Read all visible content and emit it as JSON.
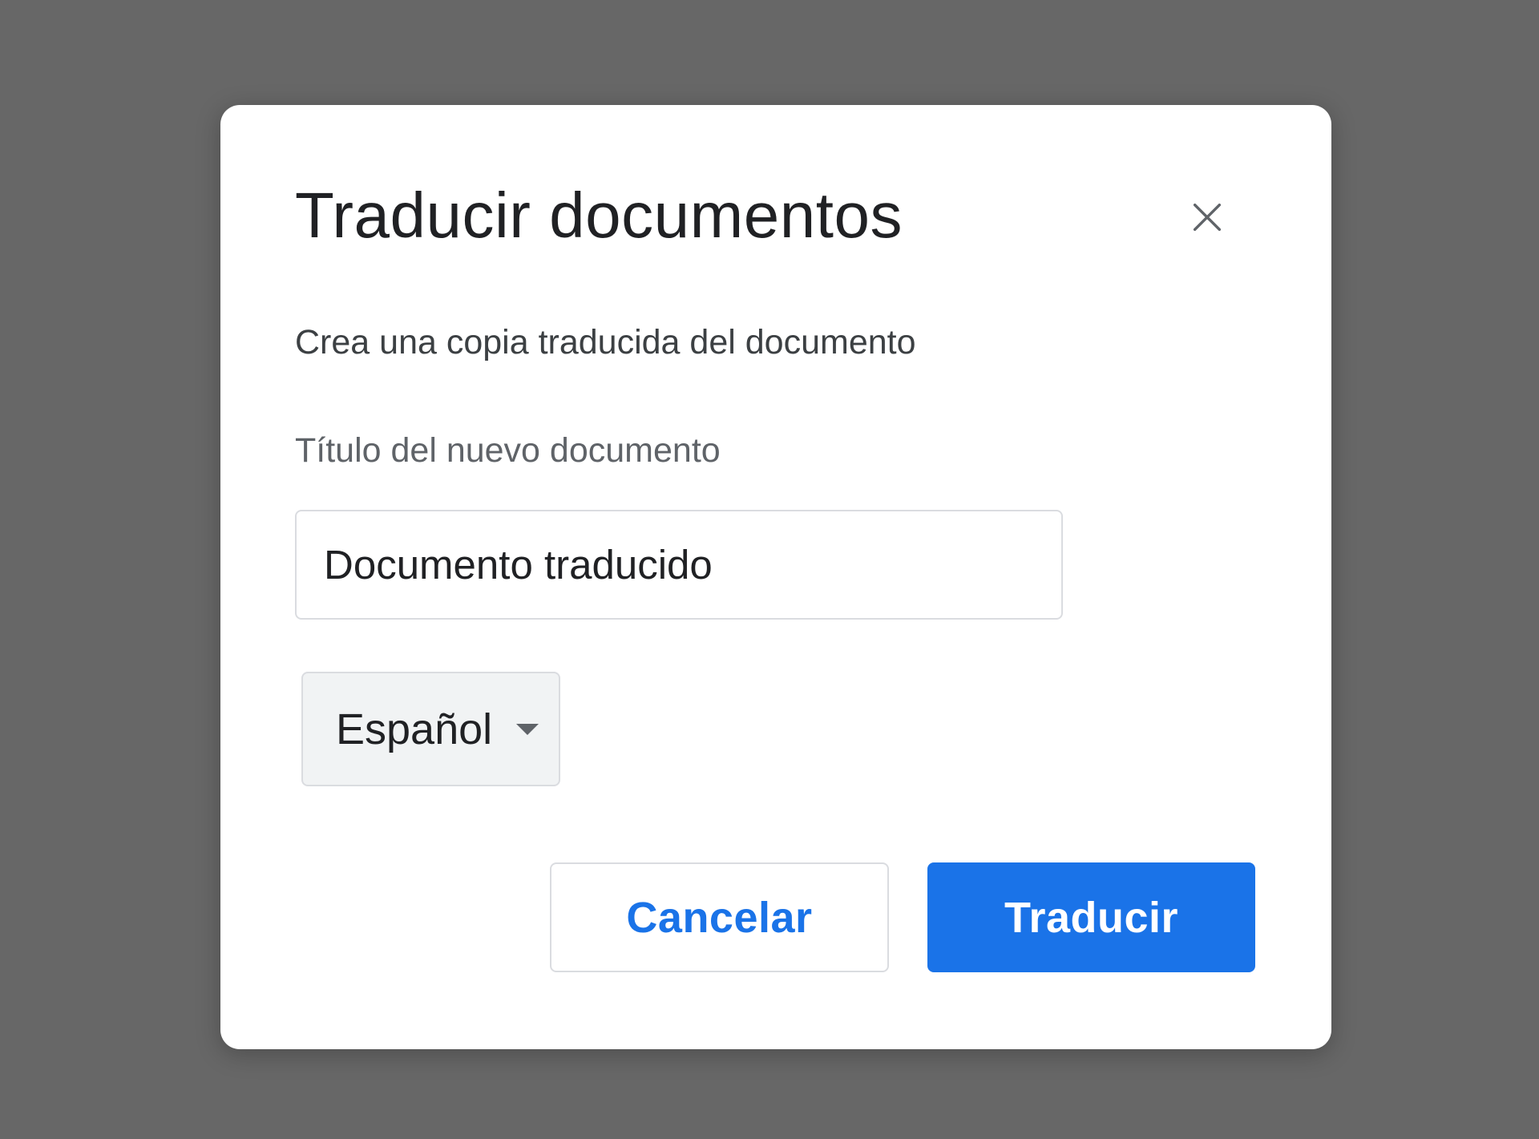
{
  "dialog": {
    "title": "Traducir documentos",
    "subtitle": "Crea una copia traducida del documento",
    "field_label": "Título del nuevo documento",
    "title_input_value": "Documento traducido",
    "language": {
      "selected": "Español"
    },
    "buttons": {
      "cancel_label": "Cancelar",
      "translate_label": "Traducir"
    },
    "close_icon": "close-icon"
  },
  "colors": {
    "accent": "#1a73e8",
    "backdrop": "#676767",
    "dialog_bg": "#ffffff"
  }
}
